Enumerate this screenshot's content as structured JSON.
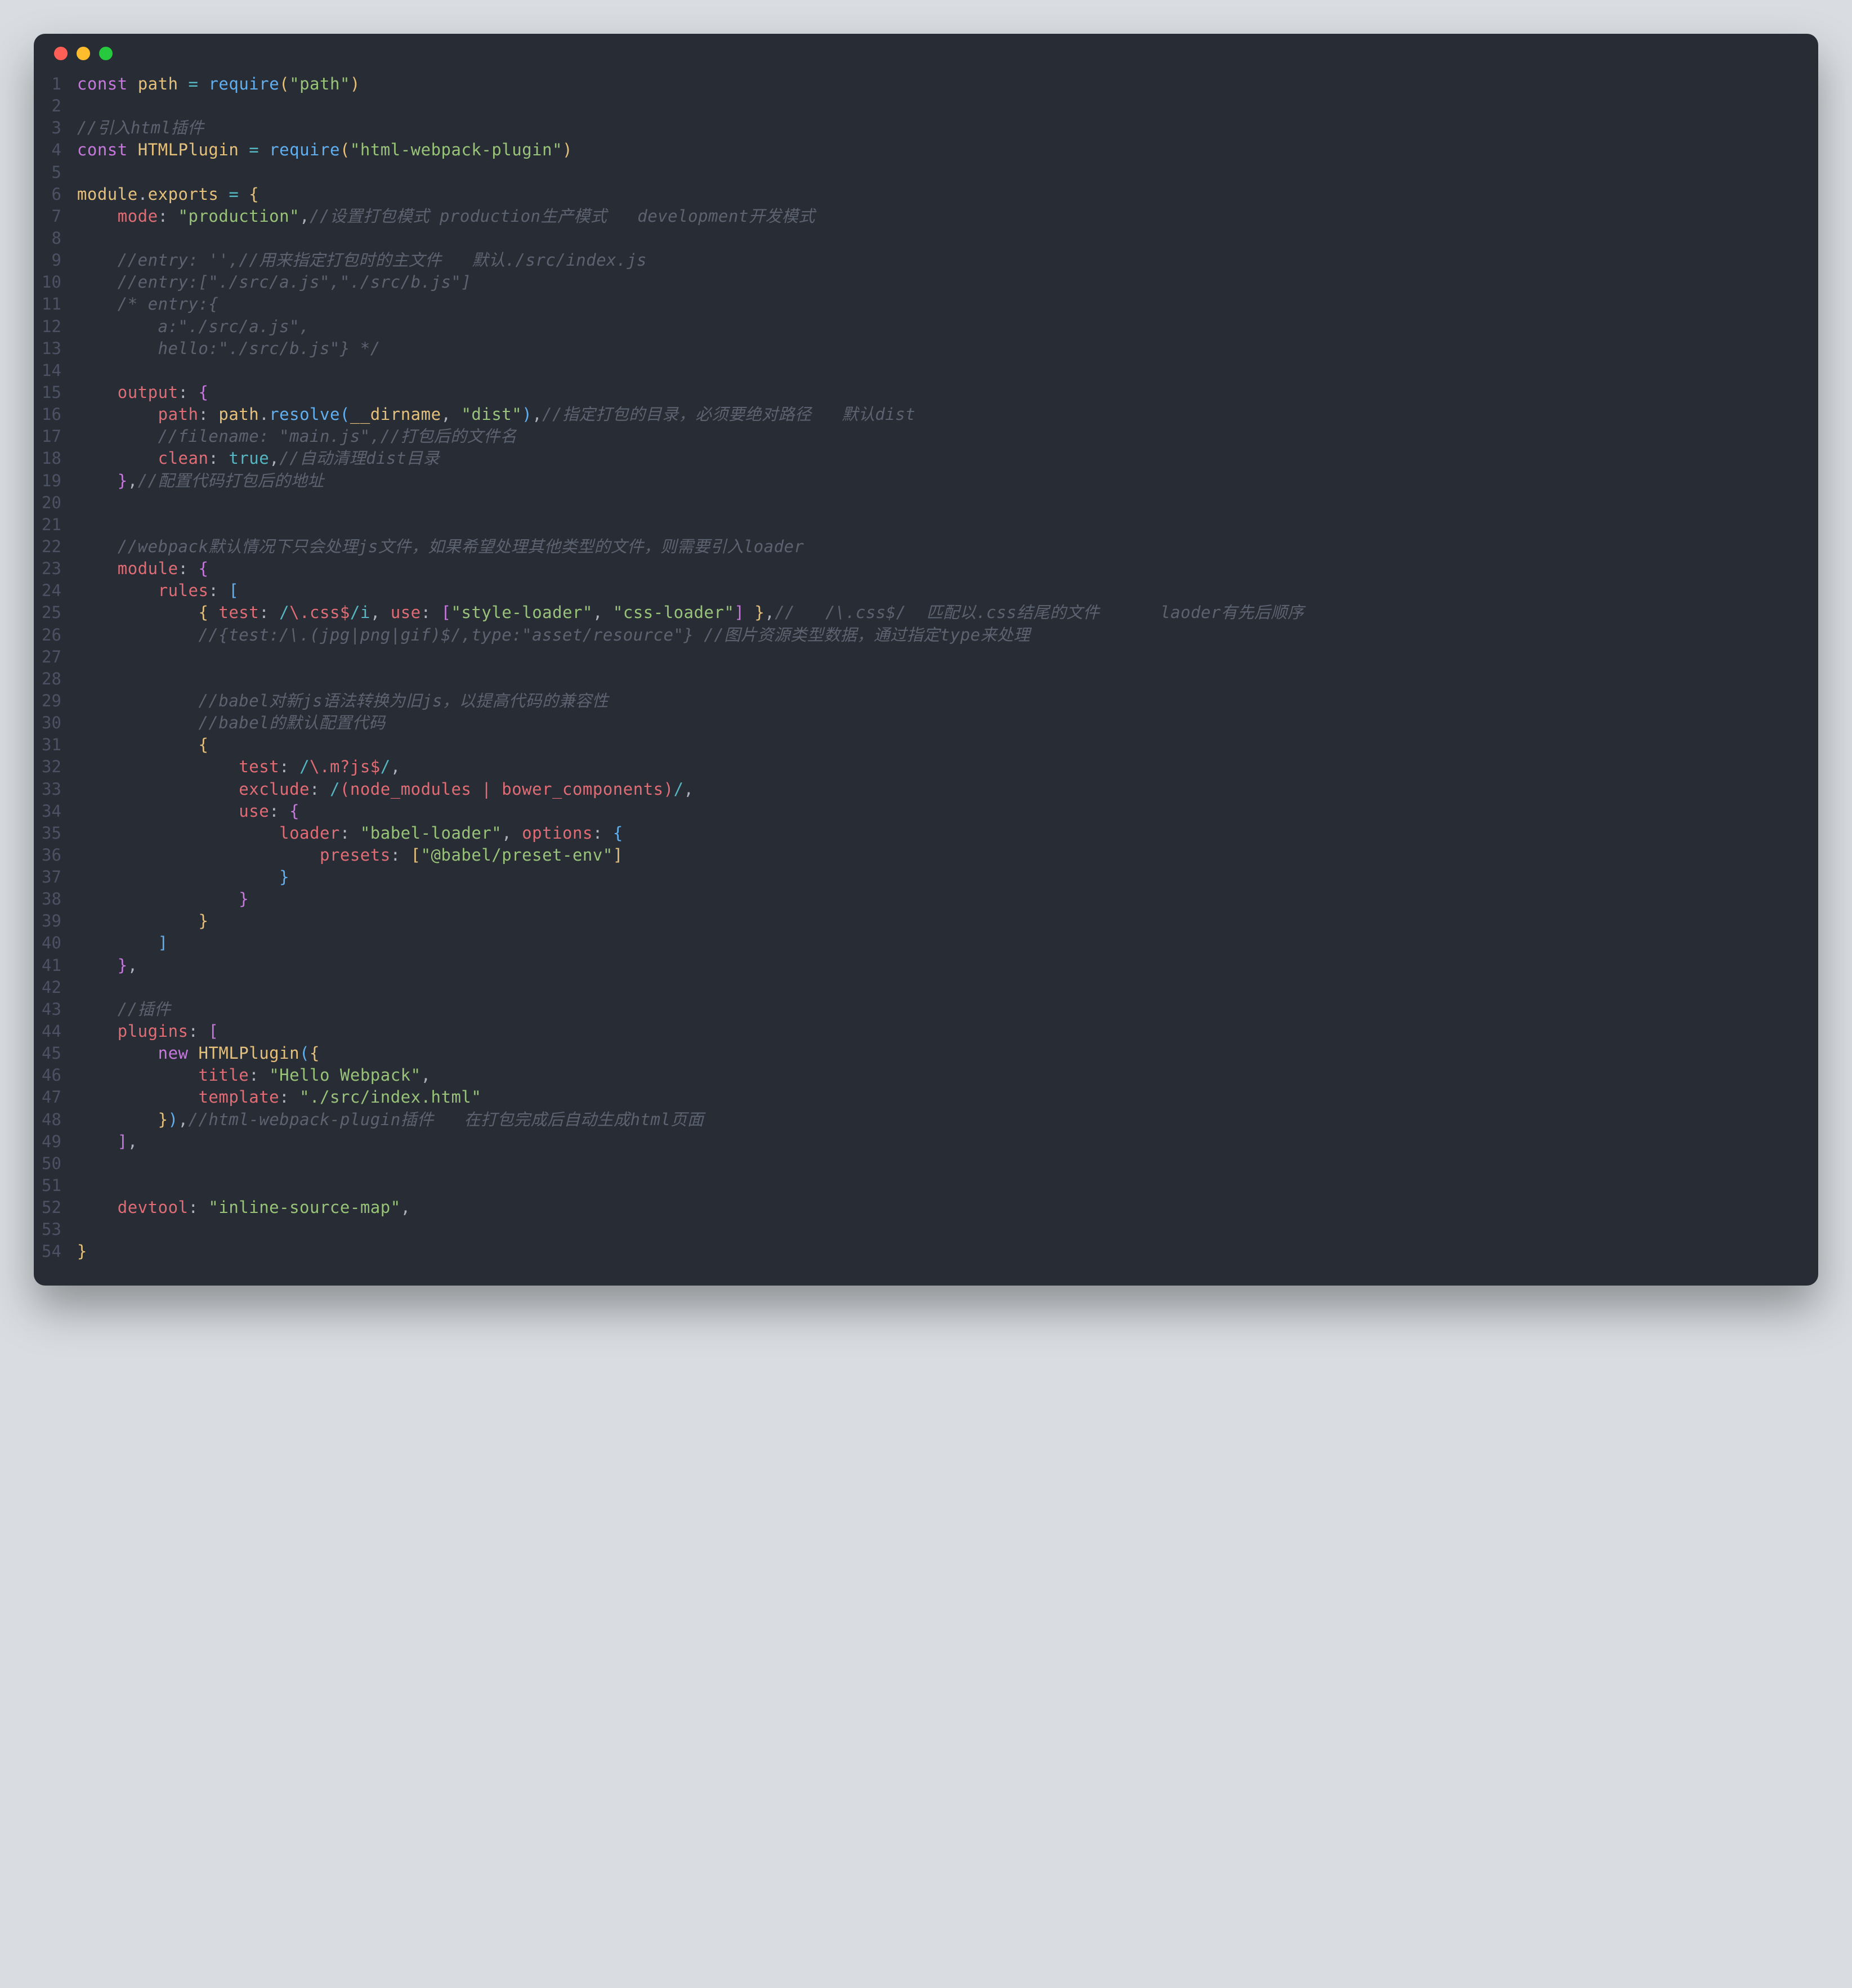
{
  "window": {
    "dots": [
      "close",
      "minimize",
      "zoom"
    ]
  },
  "lines": {
    "1": {
      "num": "1",
      "html": "<span class=kw>const</span> <span class=def>path</span> <span class=op>=</span> <span class=fn>require</span><span class=y>(</span><span class=str>\"path\"</span><span class=y>)</span>"
    },
    "2": {
      "num": "2",
      "html": ""
    },
    "3": {
      "num": "3",
      "html": "<span class=com>//引入html插件</span>"
    },
    "4": {
      "num": "4",
      "html": "<span class=kw>const</span> <span class=def>HTMLPlugin</span> <span class=op>=</span> <span class=fn>require</span><span class=y>(</span><span class=str>\"html-webpack-plugin\"</span><span class=y>)</span>"
    },
    "5": {
      "num": "5",
      "html": ""
    },
    "6": {
      "num": "6",
      "html": "<span class=def>module</span><span class=p>.</span><span class=def>exports</span> <span class=op>=</span> <span class=y>{</span>"
    },
    "7": {
      "num": "7",
      "html": "    <span class=prop>mode</span><span class=p>:</span> <span class=str>\"production\"</span><span class=p>,</span><span class=com>//设置打包模式 production生产模式   development开发模式</span>"
    },
    "8": {
      "num": "8",
      "html": ""
    },
    "9": {
      "num": "9",
      "html": "    <span class=com>//entry: '',//用来指定打包时的主文件   默认./src/index.js</span>"
    },
    "10": {
      "num": "10",
      "html": "    <span class=com>//entry:[\"./src/a.js\",\"./src/b.js\"]</span>"
    },
    "11": {
      "num": "11",
      "html": "    <span class=com>/* entry:{</span>"
    },
    "12": {
      "num": "12",
      "html": "<span class=com>        a:\"./src/a.js\",</span>"
    },
    "13": {
      "num": "13",
      "html": "<span class=com>        hello:\"./src/b.js\"} */</span>"
    },
    "14": {
      "num": "14",
      "html": ""
    },
    "15": {
      "num": "15",
      "html": "    <span class=prop>output</span><span class=p>:</span> <span class=m>{</span>"
    },
    "16": {
      "num": "16",
      "html": "        <span class=prop>path</span><span class=p>:</span> <span class=def>path</span><span class=p>.</span><span class=fn>resolve</span><span class=b>(</span><span class=def>__dirname</span><span class=p>,</span> <span class=str>\"dist\"</span><span class=b>)</span><span class=p>,</span><span class=com>//指定打包的目录，必须要绝对路径   默认dist</span>"
    },
    "17": {
      "num": "17",
      "html": "        <span class=com>//filename: \"main.js\",//打包后的文件名</span>"
    },
    "18": {
      "num": "18",
      "html": "        <span class=prop>clean</span><span class=p>:</span> <span class=resl>true</span><span class=p>,</span><span class=com>//自动清理dist目录</span>"
    },
    "19": {
      "num": "19",
      "html": "    <span class=m>}</span><span class=p>,</span><span class=com>//配置代码打包后的地址</span>"
    },
    "20": {
      "num": "20",
      "html": ""
    },
    "21": {
      "num": "21",
      "html": ""
    },
    "22": {
      "num": "22",
      "html": "    <span class=com>//webpack默认情况下只会处理js文件，如果希望处理其他类型的文件，则需要引入loader</span>"
    },
    "23": {
      "num": "23",
      "html": "    <span class=prop>module</span><span class=p>:</span> <span class=m>{</span>"
    },
    "24": {
      "num": "24",
      "html": "        <span class=prop>rules</span><span class=p>:</span> <span class=b>[</span>"
    },
    "25": {
      "num": "25",
      "html": "            <span class=y>{</span> <span class=prop>test</span><span class=p>:</span> <span class=resl>/</span><span class=re>\\.css$</span><span class=resl>/i</span><span class=p>,</span> <span class=prop>use</span><span class=p>:</span> <span class=m>[</span><span class=str>\"style-loader\"</span><span class=p>,</span> <span class=str>\"css-loader\"</span><span class=m>]</span> <span class=y>}</span><span class=p>,</span><span class=com>//   /\\.css$/  匹配以.css结尾的文件      laoder有先后顺序</span>"
    },
    "26": {
      "num": "26",
      "html": "            <span class=com>//{test:/\\.(jpg|png|gif)$/,type:\"asset/resource\"} //图片资源类型数据，通过指定type来处理</span>"
    },
    "27": {
      "num": "27",
      "html": ""
    },
    "28": {
      "num": "28",
      "html": ""
    },
    "29": {
      "num": "29",
      "html": "            <span class=com>//babel对新js语法转换为旧js，以提高代码的兼容性</span>"
    },
    "30": {
      "num": "30",
      "html": "            <span class=com>//babel的默认配置代码</span>"
    },
    "31": {
      "num": "31",
      "html": "            <span class=y>{</span>"
    },
    "32": {
      "num": "32",
      "html": "                <span class=prop>test</span><span class=p>:</span> <span class=resl>/</span><span class=re>\\.m?js$</span><span class=resl>/</span><span class=p>,</span>"
    },
    "33": {
      "num": "33",
      "html": "                <span class=prop>exclude</span><span class=p>:</span> <span class=resl>/</span><span class=re>(node_modules | bower_components)</span><span class=resl>/</span><span class=p>,</span>"
    },
    "34": {
      "num": "34",
      "html": "                <span class=prop>use</span><span class=p>:</span> <span class=m>{</span>"
    },
    "35": {
      "num": "35",
      "html": "                    <span class=prop>loader</span><span class=p>:</span> <span class=str>\"babel-loader\"</span><span class=p>,</span> <span class=prop>options</span><span class=p>:</span> <span class=b>{</span>"
    },
    "36": {
      "num": "36",
      "html": "                        <span class=prop>presets</span><span class=p>:</span> <span class=y>[</span><span class=str>\"@babel/preset-env\"</span><span class=y>]</span>"
    },
    "37": {
      "num": "37",
      "html": "                    <span class=b>}</span>"
    },
    "38": {
      "num": "38",
      "html": "                <span class=m>}</span>"
    },
    "39": {
      "num": "39",
      "html": "            <span class=y>}</span>"
    },
    "40": {
      "num": "40",
      "html": "        <span class=b>]</span>"
    },
    "41": {
      "num": "41",
      "html": "    <span class=m>}</span><span class=p>,</span>"
    },
    "42": {
      "num": "42",
      "html": ""
    },
    "43": {
      "num": "43",
      "html": "    <span class=com>//插件</span>"
    },
    "44": {
      "num": "44",
      "html": "    <span class=prop>plugins</span><span class=p>:</span> <span class=m>[</span>"
    },
    "45": {
      "num": "45",
      "html": "        <span class=kw>new</span> <span class=def>HTMLPlugin</span><span class=b>(</span><span class=y>{</span>"
    },
    "46": {
      "num": "46",
      "html": "            <span class=prop>title</span><span class=p>:</span> <span class=str>\"Hello Webpack\"</span><span class=p>,</span>"
    },
    "47": {
      "num": "47",
      "html": "            <span class=prop>template</span><span class=p>:</span> <span class=str>\"./src/index.html\"</span>"
    },
    "48": {
      "num": "48",
      "html": "        <span class=y>}</span><span class=b>)</span><span class=p>,</span><span class=com>//html-webpack-plugin插件   在打包完成后自动生成html页面</span>"
    },
    "49": {
      "num": "49",
      "html": "    <span class=m>]</span><span class=p>,</span>"
    },
    "50": {
      "num": "50",
      "html": ""
    },
    "51": {
      "num": "51",
      "html": ""
    },
    "52": {
      "num": "52",
      "html": "    <span class=prop>devtool</span><span class=p>:</span> <span class=str>\"inline-source-map\"</span><span class=p>,</span>"
    },
    "53": {
      "num": "53",
      "html": ""
    },
    "54": {
      "num": "54",
      "html": "<span class=y>}</span>"
    }
  }
}
